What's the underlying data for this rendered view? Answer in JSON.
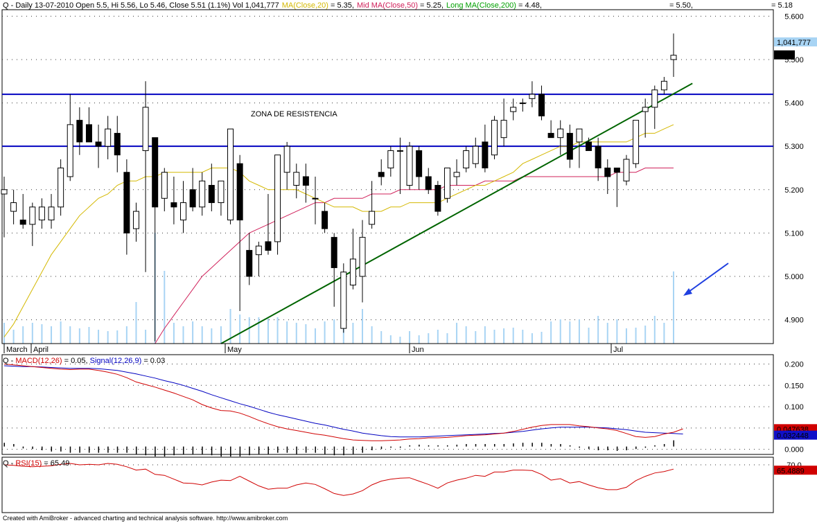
{
  "header": {
    "main_prefix": "Q - Daily 13-07-2010 Open 5.5, Hi 5.56, Lo 5.46, Close 5.51 (1.1%) Vol 1,041,777",
    "ma_label": "MA(Close,20)",
    "ma_value": " = 5.35,",
    "mid_label": "Mid MA(Close,50)",
    "mid_value": " = 5.25,",
    "long_label": "Long MA(Close,200)",
    "long_value": " = 4.48,",
    "extra1": "= 5.50,",
    "extra2": "= 5.18",
    "macd_prefix": "Q - ",
    "macd_label": "MACD(12,26)",
    "macd_value": " = 0.05, ",
    "signal_label": "Signal(12,26,9)",
    "signal_value": " = 0.03",
    "rsi_prefix": "Q - ",
    "rsi_label": "RSI(15)",
    "rsi_value": " = 65.49",
    "footer": "Created with AmiBroker - advanced charting and technical analysis software. http://www.amibroker.com"
  },
  "colors": {
    "up": "#ffffff",
    "down": "#000000",
    "ma20": "#d4b800",
    "ma50": "#d0205a",
    "ma200": "#00a000",
    "volume": "#a8d4f4",
    "resistance": "#0000c0",
    "trend": "#006400",
    "macd": "#d00000",
    "signal": "#0000c0",
    "rsi": "#d00000",
    "arrow": "#2040e0"
  },
  "chart_data": [
    {
      "type": "candlestick",
      "title": "",
      "annotation": "ZONA DE RESISTENCIA",
      "y_ticks": [
        "5.600",
        "5.500",
        "5.400",
        "5.300",
        "5.200",
        "5.100",
        "5.000",
        "4.900"
      ],
      "ylim": [
        4.845,
        5.615
      ],
      "x_labels": [
        "March",
        "April",
        "May",
        "Jun",
        "Jul"
      ],
      "last_volume_label": "1,041,777",
      "last_price_label": "5.51",
      "resistance_levels": [
        5.42,
        5.3
      ],
      "trendline": {
        "from": [
          23,
          4.845
        ],
        "to": [
          73,
          5.445
        ]
      },
      "candles": [
        {
          "o": 5.19,
          "h": 5.23,
          "l": 5.09,
          "c": 5.2
        },
        {
          "o": 5.15,
          "h": 5.2,
          "l": 5.12,
          "c": 5.17
        },
        {
          "o": 5.13,
          "h": 5.19,
          "l": 5.11,
          "c": 5.12
        },
        {
          "o": 5.12,
          "h": 5.17,
          "l": 5.07,
          "c": 5.16
        },
        {
          "o": 5.13,
          "h": 5.18,
          "l": 5.11,
          "c": 5.16
        },
        {
          "o": 5.13,
          "h": 5.19,
          "l": 5.11,
          "c": 5.16
        },
        {
          "o": 5.16,
          "h": 5.27,
          "l": 5.14,
          "c": 5.25
        },
        {
          "o": 5.23,
          "h": 5.42,
          "l": 5.22,
          "c": 5.35
        },
        {
          "o": 5.36,
          "h": 5.39,
          "l": 5.28,
          "c": 5.31
        },
        {
          "o": 5.35,
          "h": 5.39,
          "l": 5.31,
          "c": 5.31
        },
        {
          "o": 5.31,
          "h": 5.35,
          "l": 5.25,
          "c": 5.3
        },
        {
          "o": 5.3,
          "h": 5.37,
          "l": 5.27,
          "c": 5.34
        },
        {
          "o": 5.33,
          "h": 5.37,
          "l": 5.24,
          "c": 5.28
        },
        {
          "o": 5.24,
          "h": 5.27,
          "l": 5.05,
          "c": 5.1
        },
        {
          "o": 5.11,
          "h": 5.17,
          "l": 5.08,
          "c": 5.15
        },
        {
          "o": 5.29,
          "h": 5.45,
          "l": 5.01,
          "c": 5.39
        },
        {
          "o": 5.32,
          "h": 5.3,
          "l": 4.85,
          "c": 5.16
        },
        {
          "o": 5.18,
          "h": 5.25,
          "l": 5.15,
          "c": 5.24
        },
        {
          "o": 5.17,
          "h": 5.23,
          "l": 5.12,
          "c": 5.16
        },
        {
          "o": 5.13,
          "h": 5.22,
          "l": 5.1,
          "c": 5.17
        },
        {
          "o": 5.2,
          "h": 5.25,
          "l": 5.15,
          "c": 5.16
        },
        {
          "o": 5.16,
          "h": 5.24,
          "l": 5.14,
          "c": 5.22
        },
        {
          "o": 5.21,
          "h": 5.26,
          "l": 5.15,
          "c": 5.17
        },
        {
          "o": 5.17,
          "h": 5.22,
          "l": 5.14,
          "c": 5.22
        },
        {
          "o": 5.13,
          "h": 5.34,
          "l": 5.12,
          "c": 5.34
        },
        {
          "o": 5.26,
          "h": 5.28,
          "l": 4.92,
          "c": 5.13
        },
        {
          "o": 5.06,
          "h": 5.1,
          "l": 4.98,
          "c": 5.0
        },
        {
          "o": 5.05,
          "h": 5.08,
          "l": 5.0,
          "c": 5.07
        },
        {
          "o": 5.08,
          "h": 5.19,
          "l": 5.05,
          "c": 5.06
        },
        {
          "o": 5.08,
          "h": 5.28,
          "l": 5.05,
          "c": 5.28
        },
        {
          "o": 5.24,
          "h": 5.31,
          "l": 5.2,
          "c": 5.3
        },
        {
          "o": 5.21,
          "h": 5.26,
          "l": 5.18,
          "c": 5.24
        },
        {
          "o": 5.23,
          "h": 5.26,
          "l": 5.17,
          "c": 5.21
        },
        {
          "o": 5.18,
          "h": 5.23,
          "l": 5.12,
          "c": 5.18
        },
        {
          "o": 5.15,
          "h": 5.17,
          "l": 5.1,
          "c": 5.11
        },
        {
          "o": 5.09,
          "h": 5.1,
          "l": 4.93,
          "c": 5.02
        },
        {
          "o": 4.88,
          "h": 5.03,
          "l": 4.87,
          "c": 5.01
        },
        {
          "o": 4.98,
          "h": 5.11,
          "l": 4.97,
          "c": 5.04
        },
        {
          "o": 5.0,
          "h": 5.13,
          "l": 4.94,
          "c": 5.09
        },
        {
          "o": 5.12,
          "h": 5.22,
          "l": 5.11,
          "c": 5.15
        },
        {
          "o": 5.24,
          "h": 5.27,
          "l": 5.21,
          "c": 5.23
        },
        {
          "o": 5.25,
          "h": 5.3,
          "l": 5.23,
          "c": 5.29
        },
        {
          "o": 5.29,
          "h": 5.32,
          "l": 5.19,
          "c": 5.29
        },
        {
          "o": 5.21,
          "h": 5.31,
          "l": 5.2,
          "c": 5.3
        },
        {
          "o": 5.29,
          "h": 5.3,
          "l": 5.2,
          "c": 5.23
        },
        {
          "o": 5.23,
          "h": 5.25,
          "l": 5.19,
          "c": 5.2
        },
        {
          "o": 5.21,
          "h": 5.22,
          "l": 5.14,
          "c": 5.15
        },
        {
          "o": 5.18,
          "h": 5.25,
          "l": 5.17,
          "c": 5.25
        },
        {
          "o": 5.23,
          "h": 5.27,
          "l": 5.21,
          "c": 5.24
        },
        {
          "o": 5.25,
          "h": 5.3,
          "l": 5.24,
          "c": 5.29
        },
        {
          "o": 5.26,
          "h": 5.32,
          "l": 5.25,
          "c": 5.3
        },
        {
          "o": 5.31,
          "h": 5.35,
          "l": 5.24,
          "c": 5.25
        },
        {
          "o": 5.28,
          "h": 5.37,
          "l": 5.27,
          "c": 5.36
        },
        {
          "o": 5.32,
          "h": 5.41,
          "l": 5.3,
          "c": 5.36
        },
        {
          "o": 5.38,
          "h": 5.41,
          "l": 5.36,
          "c": 5.39
        },
        {
          "o": 5.4,
          "h": 5.41,
          "l": 5.38,
          "c": 5.4
        },
        {
          "o": 5.41,
          "h": 5.45,
          "l": 5.39,
          "c": 5.42
        },
        {
          "o": 5.42,
          "h": 5.44,
          "l": 5.36,
          "c": 5.37
        },
        {
          "o": 5.33,
          "h": 5.36,
          "l": 5.32,
          "c": 5.32
        },
        {
          "o": 5.32,
          "h": 5.36,
          "l": 5.28,
          "c": 5.34
        },
        {
          "o": 5.33,
          "h": 5.35,
          "l": 5.25,
          "c": 5.27
        },
        {
          "o": 5.31,
          "h": 5.34,
          "l": 5.25,
          "c": 5.34
        },
        {
          "o": 5.31,
          "h": 5.32,
          "l": 5.29,
          "c": 5.29
        },
        {
          "o": 5.3,
          "h": 5.32,
          "l": 5.22,
          "c": 5.25
        },
        {
          "o": 5.25,
          "h": 5.27,
          "l": 5.19,
          "c": 5.23
        },
        {
          "o": 5.25,
          "h": 5.25,
          "l": 5.16,
          "c": 5.24
        },
        {
          "o": 5.22,
          "h": 5.28,
          "l": 5.21,
          "c": 5.27
        },
        {
          "o": 5.26,
          "h": 5.36,
          "l": 5.25,
          "c": 5.36
        },
        {
          "o": 5.38,
          "h": 5.41,
          "l": 5.32,
          "c": 5.39
        },
        {
          "o": 5.39,
          "h": 5.44,
          "l": 5.34,
          "c": 5.43
        },
        {
          "o": 5.43,
          "h": 5.46,
          "l": 5.42,
          "c": 5.45
        },
        {
          "o": 5.5,
          "h": 5.56,
          "l": 5.46,
          "c": 5.51
        }
      ],
      "ma20": [
        4.86,
        4.89,
        4.93,
        4.97,
        5.01,
        5.05,
        5.08,
        5.11,
        5.14,
        5.16,
        5.18,
        5.19,
        5.21,
        5.22,
        5.22,
        5.23,
        5.23,
        5.24,
        5.24,
        5.24,
        5.24,
        5.24,
        5.25,
        5.25,
        5.25,
        5.24,
        5.22,
        5.21,
        5.2,
        5.2,
        5.2,
        5.2,
        5.19,
        5.18,
        5.17,
        5.16,
        5.16,
        5.16,
        5.15,
        5.15,
        5.15,
        5.16,
        5.16,
        5.17,
        5.17,
        5.17,
        5.17,
        5.18,
        5.19,
        5.2,
        5.21,
        5.21,
        5.22,
        5.23,
        5.24,
        5.26,
        5.27,
        5.28,
        5.29,
        5.3,
        5.3,
        5.31,
        5.31,
        5.31,
        5.31,
        5.31,
        5.31,
        5.32,
        5.33,
        5.33,
        5.34,
        5.35
      ],
      "ma50": [
        null,
        null,
        null,
        null,
        null,
        null,
        null,
        null,
        null,
        null,
        null,
        null,
        null,
        null,
        null,
        null,
        4.845,
        4.88,
        4.91,
        4.94,
        4.97,
        5.0,
        5.02,
        5.04,
        5.06,
        5.08,
        5.1,
        5.11,
        5.12,
        5.13,
        5.14,
        5.15,
        5.16,
        5.17,
        5.17,
        5.18,
        5.18,
        5.18,
        5.18,
        5.19,
        5.19,
        5.19,
        5.2,
        5.2,
        5.2,
        5.2,
        5.2,
        5.21,
        5.21,
        5.21,
        5.21,
        5.22,
        5.22,
        5.22,
        5.22,
        5.23,
        5.23,
        5.23,
        5.23,
        5.23,
        5.23,
        5.23,
        5.23,
        5.23,
        5.23,
        5.24,
        5.24,
        5.24,
        5.25,
        5.25,
        5.25,
        5.25
      ],
      "volume_scale_max": 1200000,
      "volumes": [
        300000,
        200000,
        250000,
        300000,
        280000,
        250000,
        320000,
        250000,
        220000,
        240000,
        200000,
        180000,
        190000,
        250000,
        600000,
        200000,
        1600000,
        1050000,
        300000,
        250000,
        320000,
        250000,
        220000,
        250000,
        500000,
        420000,
        380000,
        380000,
        360000,
        380000,
        320000,
        300000,
        280000,
        220000,
        320000,
        350000,
        350000,
        300000,
        500000,
        250000,
        180000,
        120000,
        100000,
        180000,
        120000,
        150000,
        200000,
        150000,
        300000,
        250000,
        180000,
        250000,
        200000,
        220000,
        230000,
        200000,
        150000,
        170000,
        320000,
        350000,
        320000,
        350000,
        230000,
        400000,
        300000,
        350000,
        220000,
        230000,
        260000,
        400000,
        300000,
        1041777
      ]
    },
    {
      "type": "line",
      "title": "",
      "y_ticks": [
        "0.200",
        "0.150",
        "0.100",
        "0.050",
        "0.000"
      ],
      "ylim": [
        -0.012,
        0.222
      ],
      "macd_label": "0.047638",
      "signal_label": "0.032448",
      "macd": [
        0.2,
        0.198,
        0.196,
        0.194,
        0.192,
        0.19,
        0.188,
        0.187,
        0.188,
        0.188,
        0.185,
        0.181,
        0.176,
        0.168,
        0.158,
        0.152,
        0.146,
        0.139,
        0.132,
        0.124,
        0.116,
        0.105,
        0.097,
        0.091,
        0.09,
        0.085,
        0.077,
        0.068,
        0.06,
        0.053,
        0.048,
        0.044,
        0.04,
        0.036,
        0.033,
        0.029,
        0.025,
        0.022,
        0.021,
        0.02,
        0.02,
        0.021,
        0.022,
        0.024,
        0.025,
        0.027,
        0.027,
        0.028,
        0.03,
        0.032,
        0.033,
        0.034,
        0.036,
        0.038,
        0.042,
        0.047,
        0.052,
        0.056,
        0.058,
        0.058,
        0.058,
        0.055,
        0.053,
        0.05,
        0.048,
        0.044,
        0.037,
        0.03,
        0.028,
        0.03,
        0.036,
        0.04,
        0.048
      ],
      "signal": [
        0.196,
        0.195,
        0.194,
        0.194,
        0.193,
        0.192,
        0.191,
        0.19,
        0.19,
        0.19,
        0.189,
        0.187,
        0.185,
        0.181,
        0.177,
        0.172,
        0.167,
        0.161,
        0.156,
        0.15,
        0.143,
        0.136,
        0.128,
        0.121,
        0.114,
        0.107,
        0.101,
        0.094,
        0.087,
        0.081,
        0.076,
        0.071,
        0.066,
        0.061,
        0.057,
        0.052,
        0.047,
        0.043,
        0.038,
        0.035,
        0.032,
        0.03,
        0.029,
        0.029,
        0.029,
        0.03,
        0.031,
        0.032,
        0.033,
        0.034,
        0.035,
        0.036,
        0.037,
        0.038,
        0.04,
        0.042,
        0.045,
        0.048,
        0.05,
        0.052,
        0.052,
        0.052,
        0.052,
        0.051,
        0.05,
        0.048,
        0.046,
        0.043,
        0.04,
        0.039,
        0.038,
        0.037,
        0.036
      ],
      "histogram": [
        0.006,
        0.004,
        -0.003,
        -0.004,
        -0.006,
        -0.008,
        -0.008,
        -0.01,
        -0.01,
        -0.01,
        -0.01,
        -0.01,
        -0.01,
        -0.01,
        -0.012,
        -0.014,
        -0.016,
        -0.016,
        -0.014,
        -0.013,
        -0.012,
        -0.012,
        -0.014,
        -0.016,
        -0.016,
        -0.016,
        -0.014,
        -0.012,
        -0.012,
        -0.01,
        -0.01,
        -0.012,
        -0.01,
        -0.01,
        -0.012,
        -0.014,
        -0.014,
        -0.012,
        -0.01,
        -0.006,
        -0.004,
        -0.002,
        -0.002,
        0.002,
        0.003,
        0.002,
        0.002,
        0.002,
        0.003,
        0.004,
        0.004,
        0.004,
        0.004,
        0.004,
        0.005,
        0.006,
        0.006,
        0.006,
        0.004,
        0.004,
        0.002,
        -0.002,
        -0.004,
        -0.006,
        -0.006,
        -0.007,
        -0.006,
        -0.004,
        -0.002,
        0.002,
        0.004,
        0.01
      ]
    },
    {
      "type": "line",
      "title": "",
      "y_ticks": [
        "70.0"
      ],
      "ylim": [
        20,
        78
      ],
      "rsi_label": "65.4889",
      "rsi": [
        70.0,
        69.5,
        68.5,
        68.0,
        68.5,
        69.0,
        70.5,
        71.5,
        70.0,
        70.5,
        70.0,
        71.5,
        70.5,
        68.0,
        64.5,
        65.5,
        60.0,
        59.0,
        55.0,
        51.0,
        50.5,
        49.0,
        52.0,
        54.0,
        53.5,
        58.0,
        53.0,
        48.0,
        44.5,
        45.5,
        45.5,
        49.0,
        51.0,
        49.5,
        45.0,
        40.0,
        38.0,
        39.5,
        43.0,
        49.0,
        53.0,
        55.0,
        56.0,
        56.5,
        53.0,
        49.5,
        45.5,
        51.0,
        54.0,
        56.0,
        59.0,
        58.0,
        62.5,
        62.5,
        64.5,
        64.5,
        64.0,
        60.0,
        54.0,
        55.5,
        51.0,
        52.5,
        49.0,
        46.0,
        44.0,
        44.0,
        46.5,
        53.5,
        58.0,
        61.5,
        63.0,
        65.5
      ]
    }
  ]
}
